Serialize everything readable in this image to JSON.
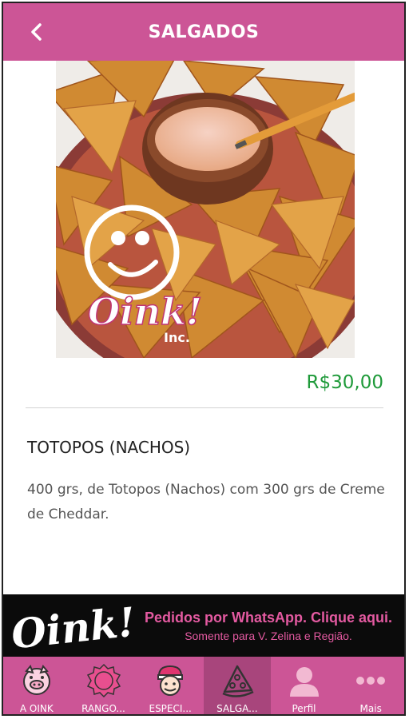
{
  "header": {
    "title": "SALGADOS"
  },
  "product": {
    "price": "R$30,00",
    "name": "TOTOPOS (NACHOS)",
    "description": "400 grs, de Totopos (Nachos) com 300 grs de Creme de Cheddar.",
    "photo_logo": {
      "main": "Oink!",
      "sub": "Inc."
    }
  },
  "banner": {
    "logo_text": "Oink!",
    "line1": "Pedidos por WhatsApp. Clique aqui.",
    "line2": "Somente para V. Zelina e Região."
  },
  "tabs": [
    {
      "label": "A OINK",
      "icon": "pig-icon"
    },
    {
      "label": "RANGO...",
      "icon": "badge-icon"
    },
    {
      "label": "ESPECI...",
      "icon": "chef-icon"
    },
    {
      "label": "SALGA...",
      "icon": "pizza-icon",
      "active": true
    },
    {
      "label": "Perfil",
      "icon": "person-icon"
    },
    {
      "label": "Mais",
      "icon": "more-dots-icon"
    }
  ],
  "colors": {
    "brand": "#cc5596",
    "brand_dark": "#a8457c",
    "price": "#1f9a3a",
    "banner_bg": "#0b0b0b",
    "banner_text": "#e45aa1"
  }
}
